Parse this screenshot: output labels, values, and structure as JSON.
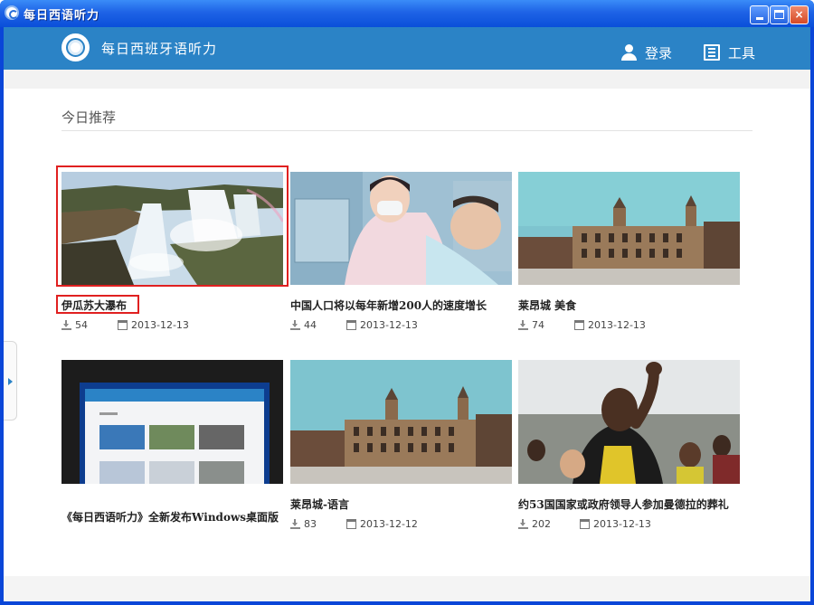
{
  "window": {
    "title": "每日西语听力",
    "minimize_label": "minimize",
    "maximize_label": "maximize",
    "close_label": "×"
  },
  "header": {
    "app_name": "每日西班牙语听力",
    "login_label": "登录",
    "tools_label": "工具"
  },
  "section": {
    "title": "今日推荐"
  },
  "cards": [
    {
      "title": "伊瓜苏大瀑布",
      "downloads": "54",
      "date": "2013-12-13",
      "image": "waterfall"
    },
    {
      "title": "中国人口将以每年新增200人的速度增长",
      "downloads": "44",
      "date": "2013-12-13",
      "image": "nurse-baby"
    },
    {
      "title": "莱昂城  美食",
      "downloads": "74",
      "date": "2013-12-13",
      "image": "town-square"
    },
    {
      "title": "《每日西语听力》全新发布Windows桌面版",
      "downloads": "",
      "date": "",
      "image": "app-screenshot"
    },
    {
      "title": "莱昂城-语言",
      "downloads": "83",
      "date": "2013-12-12",
      "image": "town-square"
    },
    {
      "title": "约53国国家或政府领导人参加曼德拉的葬礼",
      "downloads": "202",
      "date": "2013-12-13",
      "image": "crowd"
    }
  ],
  "colors": {
    "header_bg": "#2b83c6",
    "highlight": "#e02020",
    "title_bar": "#0a4fd9"
  }
}
